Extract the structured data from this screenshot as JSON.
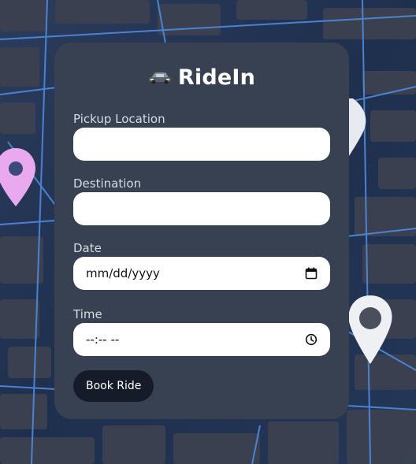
{
  "app": {
    "brand_name": "RideIn",
    "brand_icon": "car-icon"
  },
  "form": {
    "pickup": {
      "label": "Pickup Location",
      "value": ""
    },
    "destination": {
      "label": "Destination",
      "value": ""
    },
    "date": {
      "label": "Date",
      "value": "mm/dd/yyyy",
      "icon": "calendar-icon"
    },
    "time": {
      "label": "Time",
      "value": "--:-- --",
      "icon": "clock-icon"
    },
    "submit_label": "Book Ride"
  },
  "colors": {
    "card": "#384152",
    "button": "#151b28",
    "input": "#ffffff"
  }
}
